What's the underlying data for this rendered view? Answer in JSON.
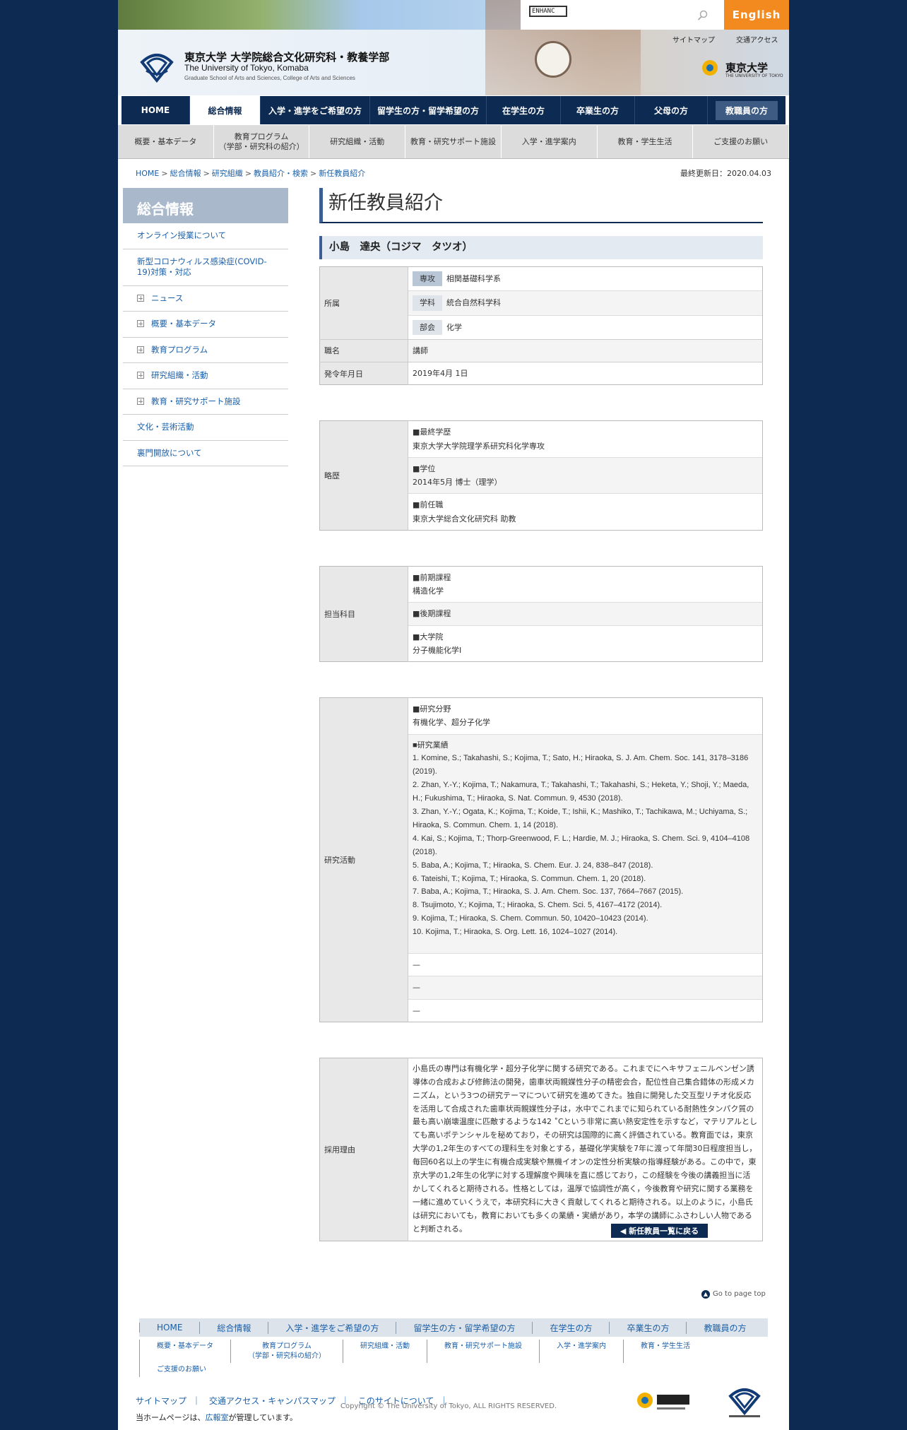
{
  "header": {
    "search_placeholder": "ENHANC",
    "english_label": "English",
    "util_links": [
      "サイトマップ",
      "交通アクセス"
    ],
    "logo_ja": "東京大学 大学院総合文化研究科・教養学部",
    "logo_en": "The University of Tokyo, Komaba",
    "logo_sub": "Graduate School of Arts and Sciences, College of Arts and Sciences",
    "utokyo_ja": "東京大学",
    "utokyo_en": "THE UNIVERSITY OF TOKYO"
  },
  "gnav": [
    "HOME",
    "総合情報",
    "入学・進学をご希望の方",
    "留学生の方・留学希望の方",
    "在学生の方",
    "卒業生の方",
    "父母の方",
    "教職員の方"
  ],
  "subnav": [
    "概要・基本データ",
    "教育プログラム\n（学部・研究科の紹介）",
    "研究組織・活動",
    "教育・研究サポート施設",
    "入学・進学案内",
    "教育・学生生活",
    "ご支援のお願い"
  ],
  "breadcrumb": [
    "HOME",
    "総合情報",
    "研究組織",
    "教員紹介・検索",
    "新任教員紹介"
  ],
  "updated": "最終更新日：2020.04.03",
  "sidebar": {
    "title": "総合情報",
    "items": [
      {
        "label": "オンライン授業について",
        "plus": false
      },
      {
        "label": "新型コロナウィルス感染症(COVID-19)対策・対応",
        "plus": false
      },
      {
        "label": "ニュース",
        "plus": true
      },
      {
        "label": "概要・基本データ",
        "plus": true
      },
      {
        "label": "教育プログラム",
        "plus": true
      },
      {
        "label": "研究組織・活動",
        "plus": true
      },
      {
        "label": "教育・研究サポート施設",
        "plus": true
      },
      {
        "label": "文化・芸術活動",
        "plus": false
      },
      {
        "label": "裏門開放について",
        "plus": false
      }
    ]
  },
  "main": {
    "title": "新任教員紹介",
    "name": "小島　達央（コジマ　タツオ）",
    "affiliation": {
      "label": "所属",
      "rows": [
        {
          "tag": "専攻",
          "value": "相関基礎科学系"
        },
        {
          "tag": "学科",
          "value": "統合自然科学科"
        },
        {
          "tag": "部会",
          "value": "化学"
        }
      ]
    },
    "position": {
      "label": "職名",
      "value": "講師"
    },
    "start_date": {
      "label": "発令年月日",
      "value": "2019年4月 1日"
    },
    "history": {
      "label": "略歴",
      "rows": [
        {
          "head": "■最終学歴",
          "value": "東京大学大学院理学系研究科化学専攻"
        },
        {
          "head": "■学位",
          "value": "2014年5月 博士（理学）"
        },
        {
          "head": "■前任職",
          "value": "東京大学総合文化研究科 助教"
        }
      ]
    },
    "courses": {
      "label": "担当科目",
      "rows": [
        {
          "head": "■前期課程",
          "value": "構造化学"
        },
        {
          "head": "■後期課程",
          "value": ""
        },
        {
          "head": "■大学院",
          "value": "分子機能化学Ⅰ"
        }
      ]
    },
    "research": {
      "label": "研究活動",
      "field_head": "■研究分野",
      "field_value": "有機化学、超分子化学",
      "works_head": "■研究業績",
      "works": [
        "1. Komine, S.; Takahashi, S.; Kojima, T.; Sato, H.; Hiraoka, S. J. Am. Chem. Soc. 141, 3178–3186 (2019).",
        "2. Zhan, Y.-Y.; Kojima, T.; Nakamura, T.; Takahashi, T.; Takahashi, S.; Heketa, Y.; Shoji, Y.; Maeda, H.; Fukushima, T.; Hiraoka, S. Nat. Commun. 9, 4530 (2018).",
        "3. Zhan, Y.-Y.; Ogata, K.; Kojima, T.; Koide, T.; Ishii, K.; Mashiko, T.; Tachikawa, M.; Uchiyama, S.; Hiraoka, S. Commun. Chem. 1, 14 (2018).",
        "4. Kai, S.; Kojima, T.; Thorp-Greenwood, F. L.; Hardie, M. J.; Hiraoka, S. Chem. Sci. 9, 4104–4108 (2018).",
        "5. Baba, A.; Kojima, T.; Hiraoka, S. Chem. Eur. J. 24, 838–847 (2018).",
        "6. Tateishi, T.; Kojima, T.; Hiraoka, S. Commun. Chem. 1, 20 (2018).",
        "7. Baba, A.; Kojima, T.; Hiraoka, S. J. Am. Chem. Soc. 137, 7664–7667 (2015).",
        "8. Tsujimoto, Y.; Kojima, T.; Hiraoka, S. Chem. Sci. 5, 4167–4172 (2014).",
        "9. Kojima, T.; Hiraoka, S. Chem. Commun. 50, 10420–10423 (2014).",
        "10. Kojima, T.; Hiraoka, S. Org. Lett. 16, 1024–1027 (2014)."
      ],
      "dashes": [
        "—",
        "—",
        "—"
      ]
    },
    "reason": {
      "label": "採用理由",
      "text": "小島氏の専門は有機化学・超分子化学に関する研究である。これまでにヘキサフェニルベンゼン誘導体の合成および修飾法の開発，歯車状両親媒性分子の精密会合，配位性自己集合錯体の形成メカニズム，という3つの研究テーマについて研究を進めてきた。独自に開発した交互型リチオ化反応を活用して合成された歯車状両親媒性分子は，水中でこれまでに知られている耐熱性タンパク質の最も高い崩壊温度に匹敵するような142 ˚Cという非常に高い熱安定性を示すなど，マテリアルとしても高いポテンシャルを秘めており，その研究は国際的に高く評価されている。教育面では，東京大学の1,2年生のすべての理科生を対象とする，基礎化学実験を7年に渡って年間30日程度担当し，毎回60名以上の学生に有機合成実験や無機イオンの定性分析実験の指導経験がある。この中で，東京大学の1,2年生の化学に対する理解度や興味を直に感じており，この経験を今後の講義担当に活かしてくれると期待される。性格としては，温厚で協調性が高く，今後教育や研究に関する業務を一緒に進めていくうえで，本研究科に大きく貢献してくれると期待される。以上のように，小島氏は研究においても，教育においても多くの業績・実績があり，本学の講師にふさわしい人物であると判断される。"
    },
    "back_label": "◀ 新任教員一覧に戻る"
  },
  "footer": {
    "gototop": "Go to page top",
    "nav": [
      "HOME",
      "総合情報",
      "入学・進学をご希望の方",
      "留学生の方・留学希望の方",
      "在学生の方",
      "卒業生の方",
      "教職員の方"
    ],
    "sub": [
      "概要・基本データ",
      "教育プログラム\n（学部・研究科の紹介）",
      "研究組織・活動",
      "教育・研究サポート施設",
      "入学・進学案内",
      "教育・学生生活",
      "ご支援のお願い"
    ],
    "links": [
      "サイトマップ",
      "交通アクセス・キャンパスマップ",
      "このサイトについて"
    ],
    "copyright": "Copyright © The University of Tokyo, ALL RIGHTS RESERVED.",
    "note_link": "広報室",
    "note_prefix": "当ホームページは、",
    "note_suffix": "が管理しています。"
  },
  "colors": {
    "navy": "#0c2a52",
    "accent": "#f28a1f",
    "link": "#1a5fa8"
  }
}
